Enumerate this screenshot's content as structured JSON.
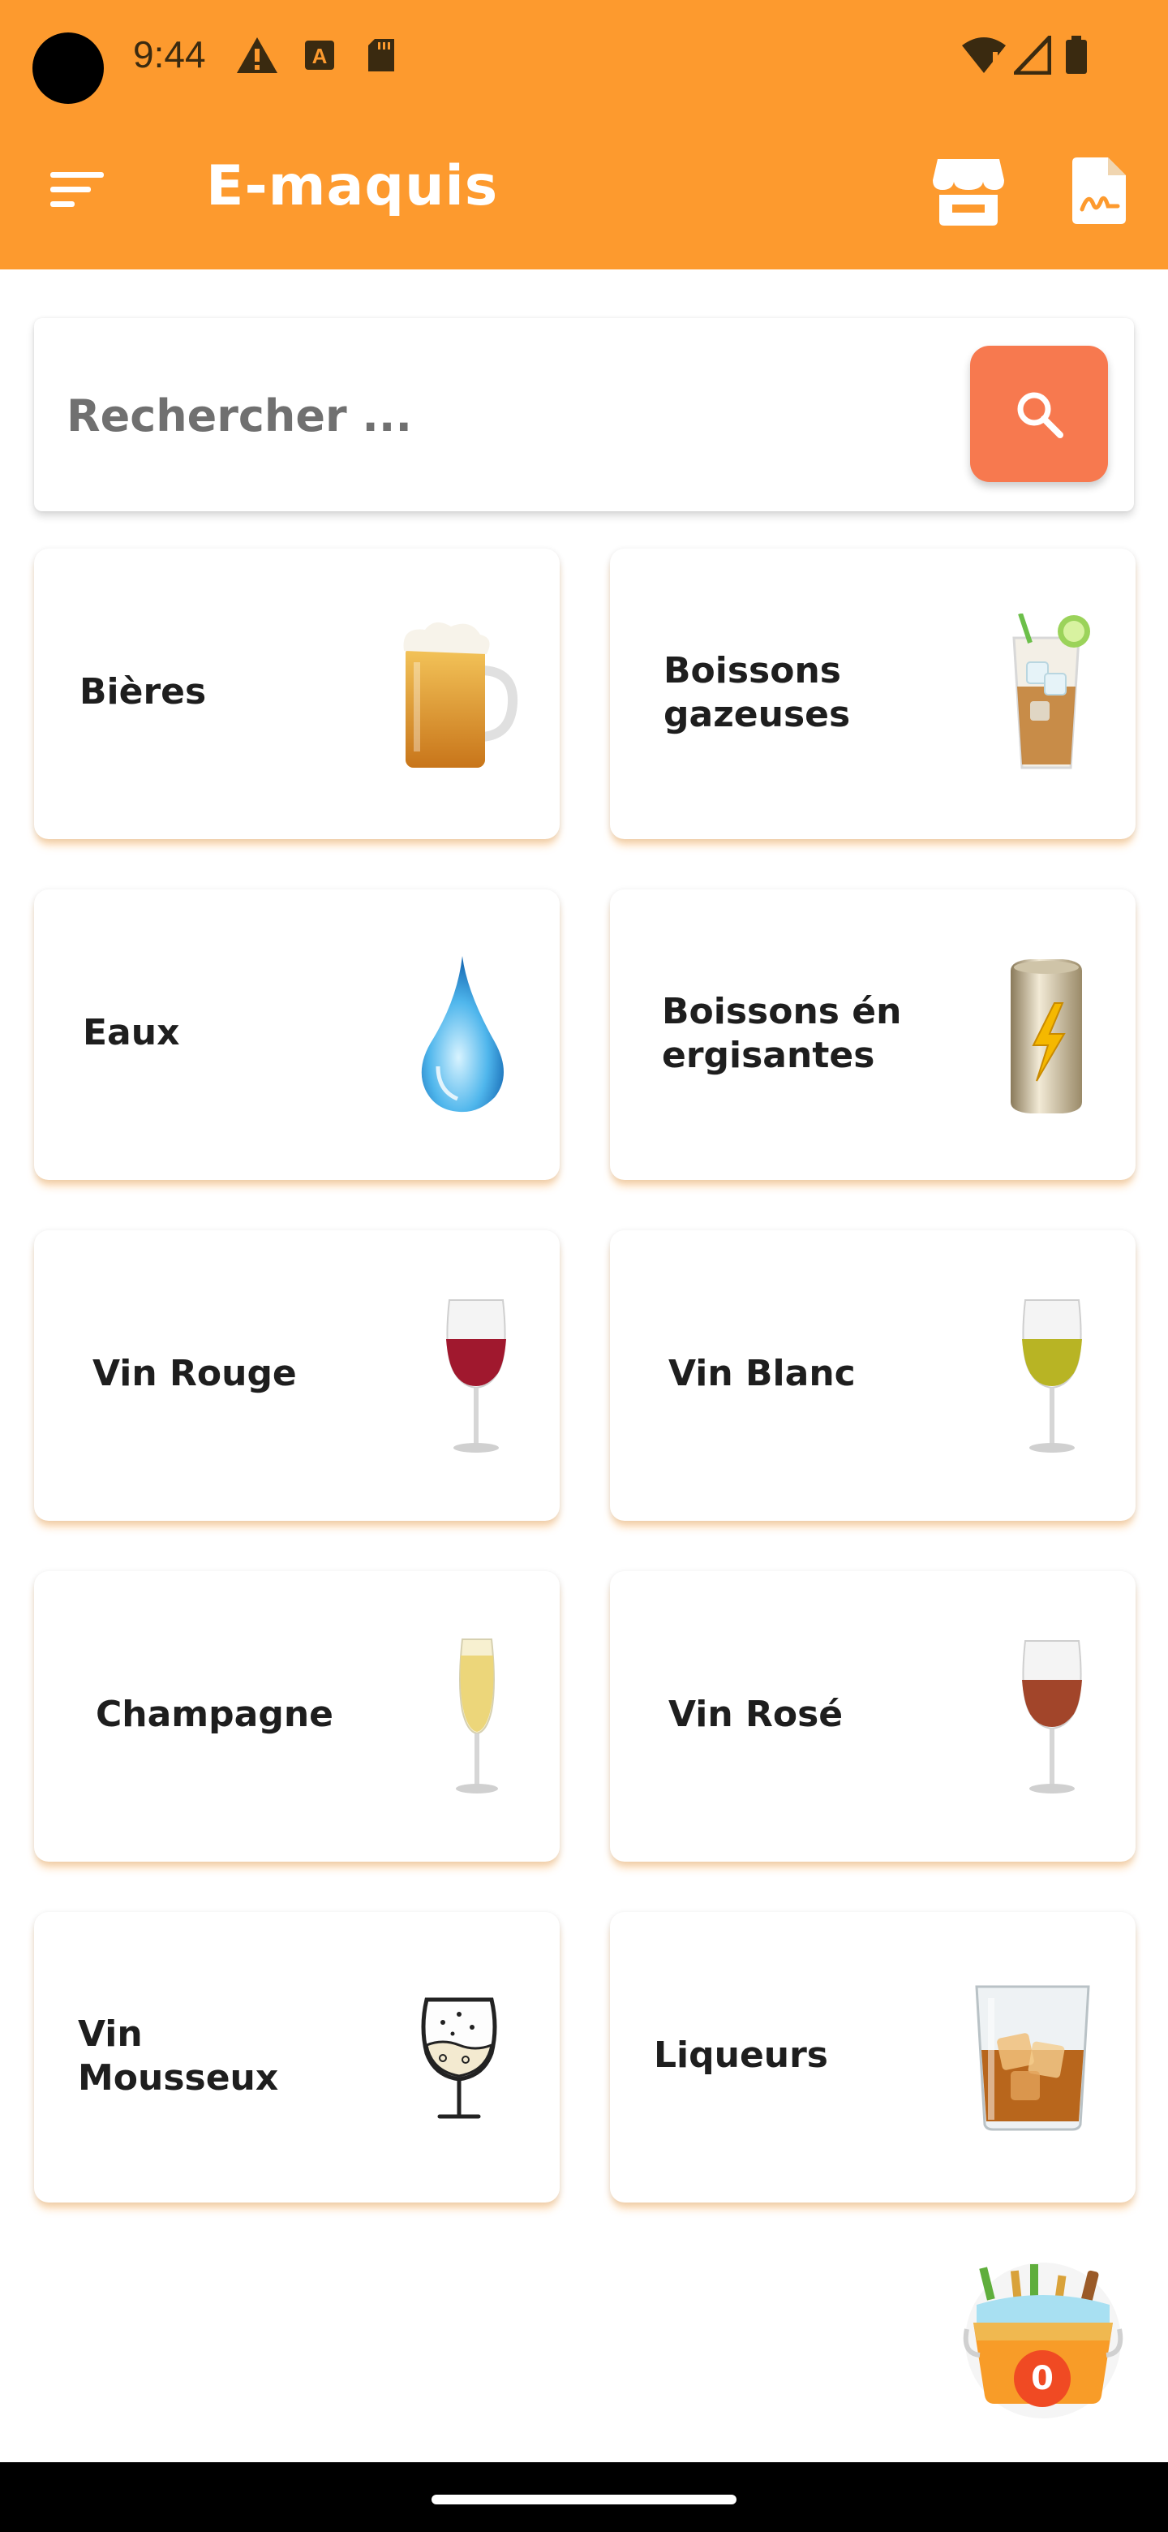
{
  "status_bar": {
    "time": "9:44",
    "icons": [
      "alert-icon",
      "a-badge-icon",
      "sd-card-icon",
      "wifi-icon",
      "signal-icon",
      "battery-icon"
    ]
  },
  "app_bar": {
    "title": "E-maquis",
    "background": "#fd9a2e",
    "actions": [
      "store-icon",
      "document-signature-icon"
    ],
    "leading": "menu-icon"
  },
  "search": {
    "placeholder": "Rechercher ...",
    "value": "",
    "button_icon": "search-icon",
    "button_color": "#f7794f"
  },
  "categories": [
    {
      "label": "Bières",
      "icon": "beer-mug-icon"
    },
    {
      "label": "Boissons\ngazeuses",
      "icon": "iced-soda-glass-icon"
    },
    {
      "label": "Eaux",
      "icon": "water-drop-icon"
    },
    {
      "label": "Boissons én\nergisantes",
      "icon": "energy-drink-can-icon"
    },
    {
      "label": "Vin Rouge",
      "icon": "red-wine-glass-icon"
    },
    {
      "label": "Vin Blanc",
      "icon": "white-wine-glass-icon"
    },
    {
      "label": "Champagne",
      "icon": "champagne-flute-icon"
    },
    {
      "label": "Vin Rosé",
      "icon": "rose-wine-glass-icon"
    },
    {
      "label": "Vin\nMousseux",
      "icon": "sparkling-wine-glass-icon"
    },
    {
      "label": "Liqueurs",
      "icon": "whiskey-glass-icon"
    }
  ],
  "cart": {
    "count": "0",
    "icon": "ice-bucket-cart-icon"
  }
}
